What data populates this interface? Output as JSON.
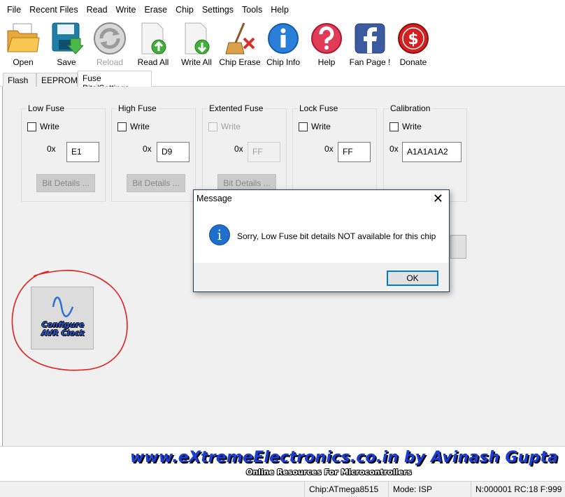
{
  "menu": [
    "File",
    "Recent Files",
    "Read",
    "Write",
    "Erase",
    "Chip",
    "Settings",
    "Tools",
    "Help"
  ],
  "toolbar": {
    "open": "Open",
    "save": "Save",
    "reload": "Reload",
    "read_all": "Read All",
    "write_all": "Write All",
    "chip_erase": "Chip Erase",
    "chip_info": "Chip Info",
    "help": "Help",
    "fan_page": "Fan Page !",
    "donate": "Donate"
  },
  "tabs": [
    "Flash",
    "EEPROM",
    "Fuse Bits/Settings"
  ],
  "fuses": {
    "low": {
      "title": "Low Fuse",
      "write_label": "Write",
      "prefix": "0x",
      "value": "E1",
      "details": "Bit Details ..."
    },
    "high": {
      "title": "High Fuse",
      "write_label": "Write",
      "prefix": "0x",
      "value": "D9",
      "details": "Bit Details ..."
    },
    "extended": {
      "title": "Extented Fuse",
      "write_label": "Write",
      "prefix": "0x",
      "value": "FF",
      "details": "Bit Details ..."
    },
    "lock": {
      "title": "Lock Fuse",
      "write_label": "Write",
      "prefix": "0x",
      "value": "FF"
    },
    "calibration": {
      "title": "Calibration",
      "write_label": "Write",
      "prefix": "0x",
      "value": "A1A1A1A2"
    }
  },
  "clock_button": {
    "line1": "Configure",
    "line2": "AVR Clock"
  },
  "banner": {
    "main": "www.eXtremeElectronics.co.in by Avinash Gupta",
    "sub": "Online Resources For Microcontrollers"
  },
  "status": {
    "chip": "Chip:ATmega8515",
    "mode": "Mode: ISP",
    "counters": "N:000001 RC:18 F:999"
  },
  "dialog": {
    "title": "Message",
    "close": "✕",
    "message": "Sorry, Low Fuse bit details NOT available for this chip",
    "ok": "OK",
    "info_glyph": "i"
  },
  "colors": {
    "accent_blue": "#0078d7",
    "panel_bg": "#f0f0f0",
    "annotation_red": "#e0201b",
    "banner_blue": "#1b3fd4"
  }
}
